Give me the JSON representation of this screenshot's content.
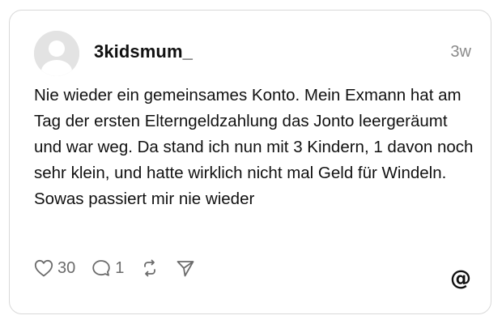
{
  "post": {
    "username": "3kidsmum_",
    "timestamp": "3w",
    "text": "Nie wieder ein gemeinsames Konto. Mein Exmann hat am Tag der ersten Elterngeldzahlung das Jonto leergeräumt und war weg. Da stand ich nun mit 3 Kindern, 1 davon noch sehr klein, und hatte wirklich nicht mal Geld für Windeln. Sowas passiert mir nie wieder"
  },
  "actions": {
    "likes": "30",
    "replies": "1",
    "icons": [
      "heart-icon",
      "comment-icon",
      "repost-icon",
      "share-icon"
    ]
  },
  "branding": {
    "logo_icon": "threads-logo-icon"
  },
  "colors": {
    "text": "#111111",
    "muted": "#8a8a8a",
    "icon": "#6b6b6b",
    "border": "#d9d9d9",
    "avatar_bg": "#e3e3e3"
  }
}
